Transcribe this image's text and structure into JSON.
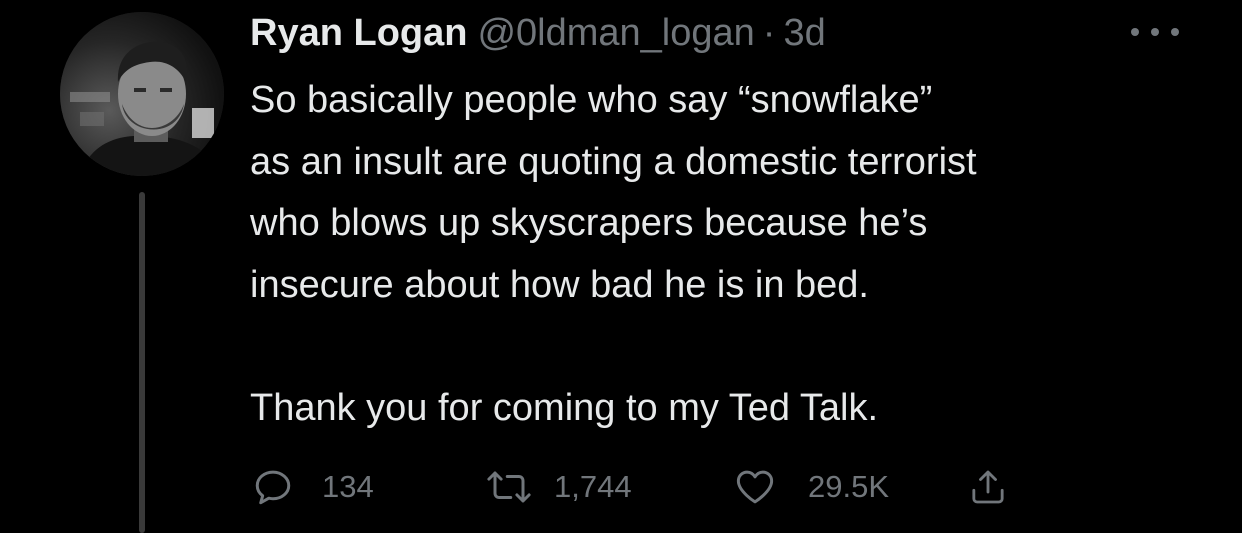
{
  "tweet": {
    "display_name": "Ryan Logan",
    "handle": "@0ldman_logan",
    "separator": "·",
    "time": "3d",
    "text_lines": [
      "So basically people who say “snowflake”",
      "as an insult are quoting a domestic terrorist",
      "who blows up skyscrapers because he’s",
      "insecure about how bad he is in bed."
    ],
    "text_closing": "Thank you for coming to my Ted Talk.",
    "actions": {
      "reply_count": "134",
      "retweet_count": "1,744",
      "like_count": "29.5K"
    },
    "icons": {
      "more": "more-icon",
      "reply": "reply-icon",
      "retweet": "retweet-icon",
      "like": "heart-icon",
      "share": "share-icon"
    }
  },
  "colors": {
    "background": "#000000",
    "primary_text": "#e7e9ea",
    "secondary_text": "#71767b",
    "thread_line": "#3a3a3a"
  }
}
